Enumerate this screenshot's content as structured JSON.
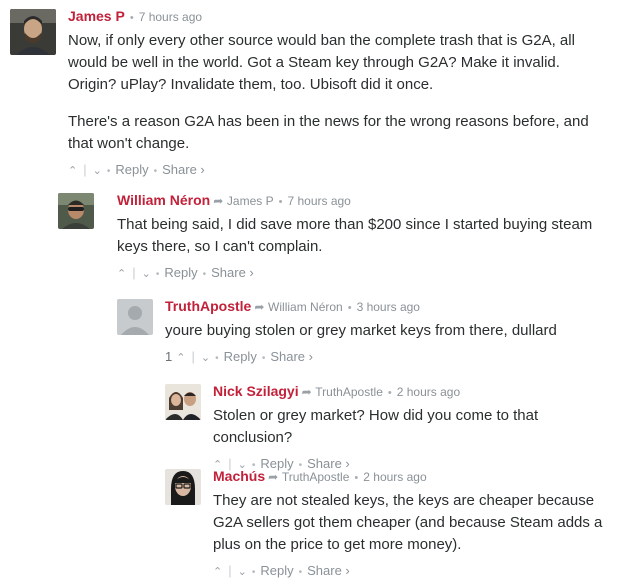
{
  "comments": [
    {
      "author": "James P",
      "reply_to": "",
      "time": "7 hours ago",
      "paragraphs": [
        "Now, if only every other source would ban the complete trash that is G2A, all would be well in the world. Got a Steam key through G2A? Make it invalid. Origin? uPlay? Invalidate them, too. Ubisoft did it once.",
        "There's a reason G2A has been in the news for the wrong reasons before, and that won't change."
      ],
      "upvotes": "",
      "reply_label": "Reply",
      "share_label": "Share ›"
    },
    {
      "author": "William Néron",
      "reply_to": "James P",
      "time": "7 hours ago",
      "paragraphs": [
        "That being said, I did save more than $200 since I started buying steam keys there, so I can't complain."
      ],
      "upvotes": "",
      "reply_label": "Reply",
      "share_label": "Share ›"
    },
    {
      "author": "TruthApostle",
      "reply_to": "William Néron",
      "time": "3 hours ago",
      "paragraphs": [
        "youre buying stolen or grey market keys from there, dullard"
      ],
      "upvotes": "1",
      "reply_label": "Reply",
      "share_label": "Share ›"
    },
    {
      "author": "Nick Szilagyi",
      "reply_to": "TruthApostle",
      "time": "2 hours ago",
      "paragraphs": [
        "Stolen or grey market? How did you come to that conclusion?"
      ],
      "upvotes": "",
      "reply_label": "Reply",
      "share_label": "Share ›"
    },
    {
      "author": "Machús",
      "reply_to": "TruthApostle",
      "time": "2 hours ago",
      "paragraphs": [
        "They are not stealed keys, the keys are cheaper because G2A sellers got them cheaper (and because Steam adds a plus on the price to get more money)."
      ],
      "upvotes": "",
      "reply_label": "Reply",
      "share_label": "Share ›"
    }
  ]
}
